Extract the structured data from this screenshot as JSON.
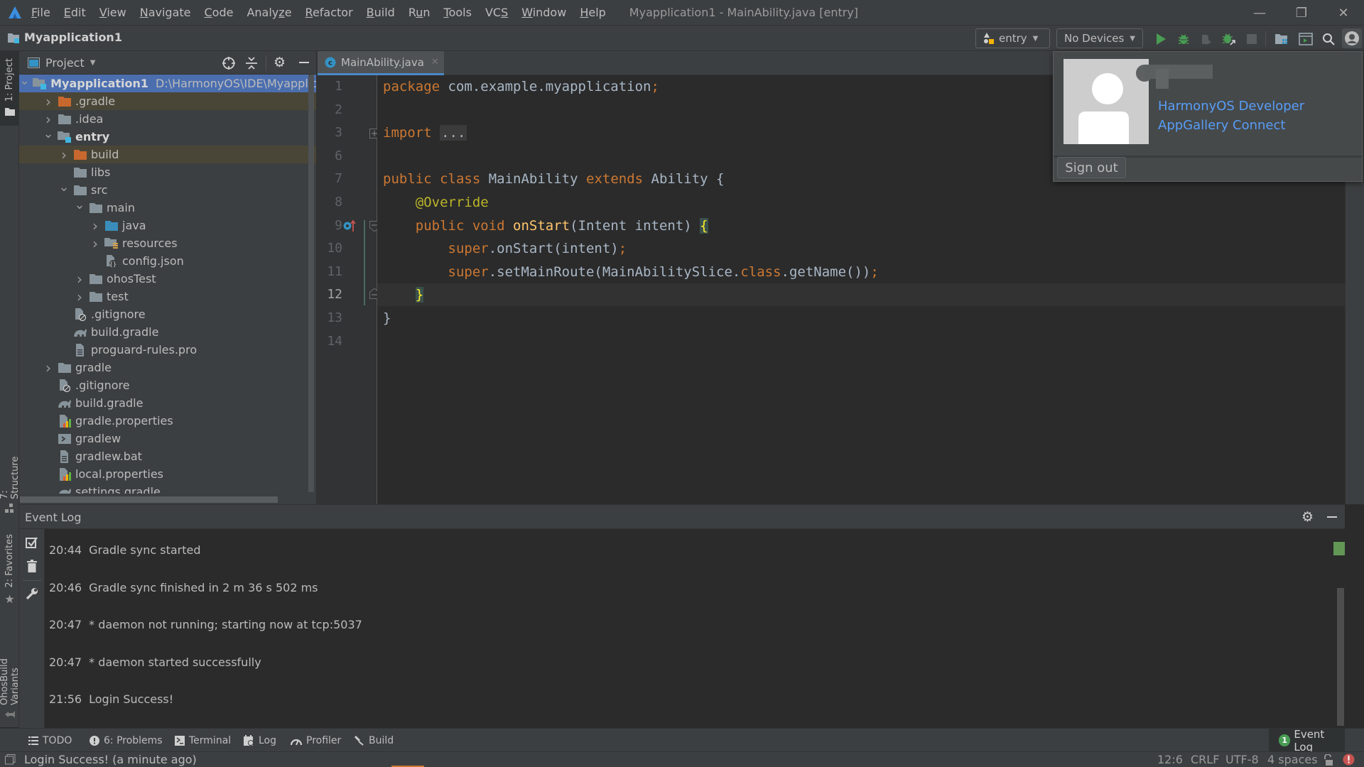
{
  "titlebar": {
    "menu": [
      {
        "label": "File",
        "mnemonic": "F"
      },
      {
        "label": "Edit",
        "mnemonic": "E"
      },
      {
        "label": "View",
        "mnemonic": "V"
      },
      {
        "label": "Navigate",
        "mnemonic": "N"
      },
      {
        "label": "Code",
        "mnemonic": "C"
      },
      {
        "label": "Analyze",
        "mnemonic": "z"
      },
      {
        "label": "Refactor",
        "mnemonic": "R"
      },
      {
        "label": "Build",
        "mnemonic": "B"
      },
      {
        "label": "Run",
        "mnemonic": "u"
      },
      {
        "label": "Tools",
        "mnemonic": "T"
      },
      {
        "label": "VCS",
        "mnemonic": "S"
      },
      {
        "label": "Window",
        "mnemonic": "W"
      },
      {
        "label": "Help",
        "mnemonic": "H"
      }
    ],
    "window_title": "Myapplication1 - MainAbility.java [entry]",
    "controls": {
      "minimize": "—",
      "restore": "❐",
      "close": "✕"
    }
  },
  "navbar": {
    "breadcrumb": "Myapplication1",
    "run_config": "entry",
    "device": "No Devices",
    "icons": [
      "run-icon",
      "debug-icon",
      "attach-debugger-icon",
      "apply-changes-icon",
      "stop-icon",
      "project-structure-icon",
      "device-manager-icon",
      "search-icon",
      "account-icon"
    ]
  },
  "left_stripe": {
    "tabs": [
      {
        "label": "1: Project"
      },
      {
        "label": "7: Structure"
      },
      {
        "label": "2: Favorites"
      },
      {
        "label": "OhosBuild Variants"
      }
    ]
  },
  "project_panel": {
    "title": "Project",
    "tree": [
      {
        "label": "Myapplication1",
        "path": "D:\\HarmonyOS\\IDE\\Myapplicatio",
        "depth": 0,
        "arrow": "down",
        "icon": "module-folder",
        "bold": true,
        "state": "selected"
      },
      {
        "label": ".gradle",
        "depth": 1,
        "arrow": "right",
        "icon": "excluded-folder",
        "state": "excluded"
      },
      {
        "label": ".idea",
        "depth": 1,
        "arrow": "right",
        "icon": "folder"
      },
      {
        "label": "entry",
        "depth": 1,
        "arrow": "down",
        "icon": "module-folder",
        "bold": true
      },
      {
        "label": "build",
        "depth": 2,
        "arrow": "right",
        "icon": "excluded-folder",
        "state": "excluded"
      },
      {
        "label": "libs",
        "depth": 2,
        "arrow": "",
        "icon": "folder"
      },
      {
        "label": "src",
        "depth": 2,
        "arrow": "down",
        "icon": "folder"
      },
      {
        "label": "main",
        "depth": 3,
        "arrow": "down",
        "icon": "folder"
      },
      {
        "label": "java",
        "depth": 4,
        "arrow": "right",
        "icon": "source-folder"
      },
      {
        "label": "resources",
        "depth": 4,
        "arrow": "right",
        "icon": "resources-folder"
      },
      {
        "label": "config.json",
        "depth": 4,
        "arrow": "",
        "icon": "json-file"
      },
      {
        "label": "ohosTest",
        "depth": 3,
        "arrow": "right",
        "icon": "folder"
      },
      {
        "label": "test",
        "depth": 3,
        "arrow": "right",
        "icon": "folder"
      },
      {
        "label": ".gitignore",
        "depth": 2,
        "arrow": "",
        "icon": "ignore-file"
      },
      {
        "label": "build.gradle",
        "depth": 2,
        "arrow": "",
        "icon": "gradle-file"
      },
      {
        "label": "proguard-rules.pro",
        "depth": 2,
        "arrow": "",
        "icon": "text-file"
      },
      {
        "label": "gradle",
        "depth": 1,
        "arrow": "right",
        "icon": "folder"
      },
      {
        "label": ".gitignore",
        "depth": 1,
        "arrow": "",
        "icon": "ignore-file"
      },
      {
        "label": "build.gradle",
        "depth": 1,
        "arrow": "",
        "icon": "gradle-file"
      },
      {
        "label": "gradle.properties",
        "depth": 1,
        "arrow": "",
        "icon": "properties-file"
      },
      {
        "label": "gradlew",
        "depth": 1,
        "arrow": "",
        "icon": "shell-file"
      },
      {
        "label": "gradlew.bat",
        "depth": 1,
        "arrow": "",
        "icon": "text-file"
      },
      {
        "label": "local.properties",
        "depth": 1,
        "arrow": "",
        "icon": "properties-file"
      },
      {
        "label": "settings.gradle",
        "depth": 1,
        "arrow": "",
        "icon": "gradle-file"
      }
    ]
  },
  "editor": {
    "tab": {
      "label": "MainAbility.java",
      "icon": "java-class-icon"
    },
    "current_line": 12,
    "lines": [
      {
        "num": "1",
        "tokens": [
          {
            "t": "package ",
            "c": "kw"
          },
          {
            "t": "com.example.myapplication",
            "c": ""
          },
          {
            "t": ";",
            "c": "kw"
          }
        ]
      },
      {
        "num": "2",
        "tokens": []
      },
      {
        "num": "3",
        "tokens": [
          {
            "t": "import ",
            "c": "kw"
          },
          {
            "t": "...",
            "c": "fold-ellipsis"
          }
        ]
      },
      {
        "num": "6",
        "tokens": []
      },
      {
        "num": "7",
        "tokens": [
          {
            "t": "public class ",
            "c": "kw"
          },
          {
            "t": "MainAbility ",
            "c": ""
          },
          {
            "t": "extends ",
            "c": "kw"
          },
          {
            "t": "Ability {",
            "c": ""
          }
        ]
      },
      {
        "num": "8",
        "tokens": [
          {
            "t": "    ",
            "c": ""
          },
          {
            "t": "@Override",
            "c": "ann"
          }
        ]
      },
      {
        "num": "9",
        "tokens": [
          {
            "t": "    ",
            "c": ""
          },
          {
            "t": "public void ",
            "c": "kw"
          },
          {
            "t": "onStart",
            "c": "fn"
          },
          {
            "t": "(Intent intent) ",
            "c": ""
          },
          {
            "t": "{",
            "c": "brace-hl"
          }
        ]
      },
      {
        "num": "10",
        "tokens": [
          {
            "t": "        ",
            "c": ""
          },
          {
            "t": "super",
            "c": "kw"
          },
          {
            "t": ".onStart(intent)",
            "c": ""
          },
          {
            "t": ";",
            "c": "kw"
          }
        ]
      },
      {
        "num": "11",
        "tokens": [
          {
            "t": "        ",
            "c": ""
          },
          {
            "t": "super",
            "c": "kw"
          },
          {
            "t": ".setMainRoute(MainAbilitySlice.",
            "c": ""
          },
          {
            "t": "class",
            "c": "kw"
          },
          {
            "t": ".getName())",
            "c": ""
          },
          {
            "t": ";",
            "c": "kw"
          }
        ]
      },
      {
        "num": "12",
        "tokens": [
          {
            "t": "    ",
            "c": ""
          },
          {
            "t": "}",
            "c": "brace-hl"
          }
        ]
      },
      {
        "num": "13",
        "tokens": [
          {
            "t": "}",
            "c": ""
          }
        ]
      },
      {
        "num": "14",
        "tokens": []
      }
    ]
  },
  "account_popup": {
    "link_developer": "HarmonyOS Developer",
    "link_appgallery": "AppGallery Connect",
    "sign_out": "Sign out"
  },
  "event_log": {
    "title": "Event Log",
    "entries": [
      {
        "time": "20:44",
        "message": "Gradle sync started"
      },
      {
        "time": "20:46",
        "message": "Gradle sync finished in 2 m 36 s 502 ms"
      },
      {
        "time": "20:47",
        "message": "* daemon not running; starting now at tcp:5037"
      },
      {
        "time": "20:47",
        "message": "* daemon started successfully"
      },
      {
        "time": "21:56",
        "message": "Login Success!"
      }
    ]
  },
  "bottom_tools": {
    "items": [
      {
        "label": "TODO",
        "icon": "todo-icon"
      },
      {
        "label": "6: Problems",
        "icon": "problems-icon"
      },
      {
        "label": "Terminal",
        "icon": "terminal-icon"
      },
      {
        "label": "Log",
        "icon": "log-icon"
      },
      {
        "label": "Profiler",
        "icon": "profiler-icon"
      },
      {
        "label": "Build",
        "icon": "build-icon"
      }
    ],
    "event_log": {
      "label": "Event Log",
      "count": "1"
    }
  },
  "statusbar": {
    "message": "Login Success! (a minute ago)",
    "position": "12:6",
    "line_separator": "CRLF",
    "encoding": "UTF-8",
    "indent": "4 spaces"
  },
  "colors": {
    "accent_selection": "#4b6eaf",
    "link": "#589df6",
    "run_green": "#499c54",
    "keyword": "#cc7832",
    "error_red": "#c75450"
  }
}
